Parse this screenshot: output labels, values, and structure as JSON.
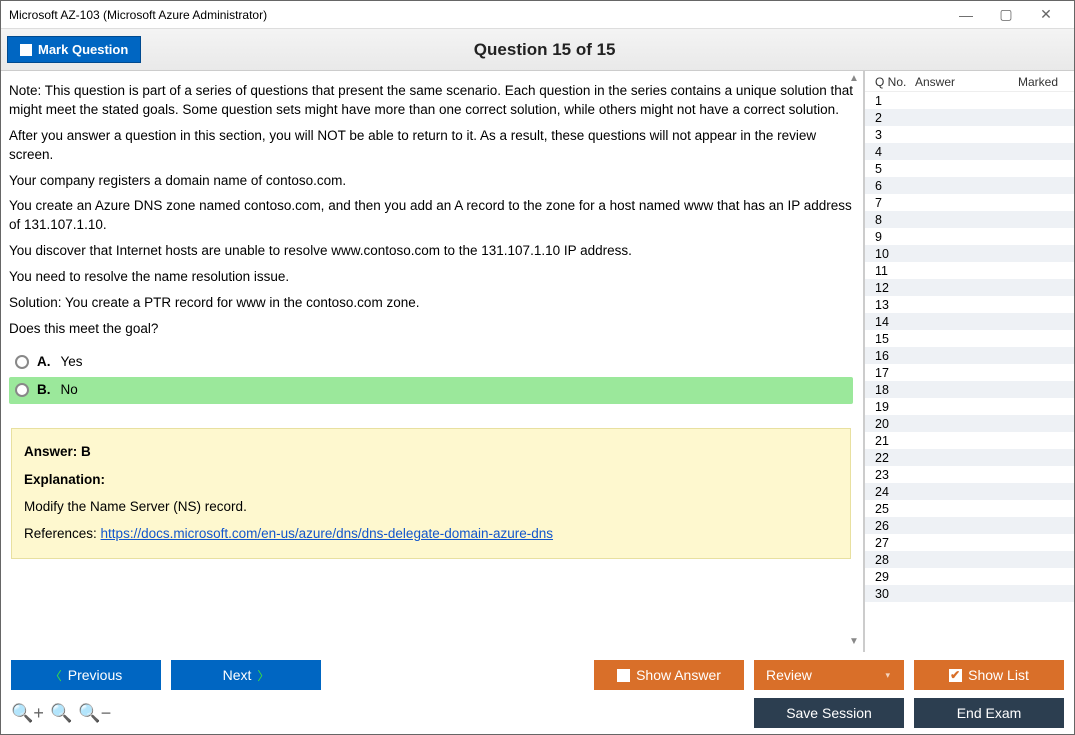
{
  "window": {
    "title": "Microsoft AZ-103 (Microsoft Azure Administrator)"
  },
  "header": {
    "mark_label": "Mark Question",
    "question_title": "Question 15 of 15"
  },
  "question": {
    "paragraphs": [
      "Note: This question is part of a series of questions that present the same scenario. Each question in the series contains a unique solution that might meet the stated goals. Some question sets might have more than one correct solution, while others might not have a correct solution.",
      "After you answer a question in this section, you will NOT be able to return to it. As a result, these questions will not appear in the review screen.",
      "Your company registers a domain name of contoso.com.",
      "You create an Azure DNS zone named contoso.com, and then you add an A record to the zone for a host named www that has an IP address of 131.107.1.10.",
      "You discover that Internet hosts are unable to resolve www.contoso.com to the 131.107.1.10 IP address.",
      "You need to resolve the name resolution issue.",
      "Solution: You create a PTR record for www in the contoso.com zone.",
      "Does this meet the goal?"
    ],
    "options": [
      {
        "letter": "A.",
        "text": "Yes",
        "correct": false
      },
      {
        "letter": "B.",
        "text": "No",
        "correct": true
      }
    ]
  },
  "answer_panel": {
    "answer_line": "Answer: B",
    "explanation_label": "Explanation:",
    "explanation_text": "Modify the Name Server (NS) record.",
    "references_label": "References: ",
    "references_url": "https://docs.microsoft.com/en-us/azure/dns/dns-delegate-domain-azure-dns"
  },
  "sidebar": {
    "headers": {
      "qno": "Q No.",
      "answer": "Answer",
      "marked": "Marked"
    },
    "row_count": 30
  },
  "footer": {
    "previous": "Previous",
    "next": "Next",
    "show_answer": "Show Answer",
    "review": "Review",
    "show_list": "Show List",
    "save_session": "Save Session",
    "end_exam": "End Exam"
  }
}
